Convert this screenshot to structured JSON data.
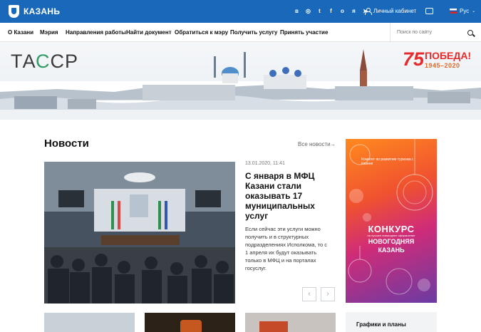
{
  "header": {
    "brand": "КАЗАНЬ",
    "socials": [
      "vk-icon",
      "instagram-icon",
      "twitter-icon",
      "facebook-icon",
      "ok-icon",
      "yandex-icon",
      "telegram-icon"
    ],
    "cabinet_label": "Личный кабинет",
    "language": "Рус"
  },
  "nav": {
    "items": [
      "О Казани",
      "Мэрия",
      "Направления работы",
      "Найти документ",
      "Обратиться к мэру",
      "Получить услугу",
      "Принять участие"
    ],
    "search_placeholder": "Поиск по сайту"
  },
  "banner": {
    "logo_left": "ТА",
    "logo_mid": "С",
    "logo_right": "СР",
    "victory_number": "75",
    "victory_text": "ПОБЕДА!",
    "victory_years": "1945–2020"
  },
  "news": {
    "title": "Новости",
    "all_link": "Все новости",
    "date": "13.01.2020, 11:41",
    "headline": "С января в МФЦ Казани стали оказывать 17 муниципальных услуг",
    "text": "Если сейчас эти услуги можно получить и в структурных подразделениях Исполкома, то с 1 апреля их будут оказывать только в МФЦ и на порталах госуслуг."
  },
  "ad": {
    "org": "Комитет по развитию туризма г. Казани",
    "contest": "КОНКУРС",
    "subtitle": "на лучшее новогоднее оформление",
    "line1": "НОВОГОДНЯЯ",
    "line2": "КАЗАНЬ"
  },
  "sidebar": {
    "plans_title": "Графики и планы"
  },
  "colors": {
    "brand_blue": "#1a68b9",
    "tass_green": "#2e9c63",
    "victory_red": "#e52b2b"
  }
}
